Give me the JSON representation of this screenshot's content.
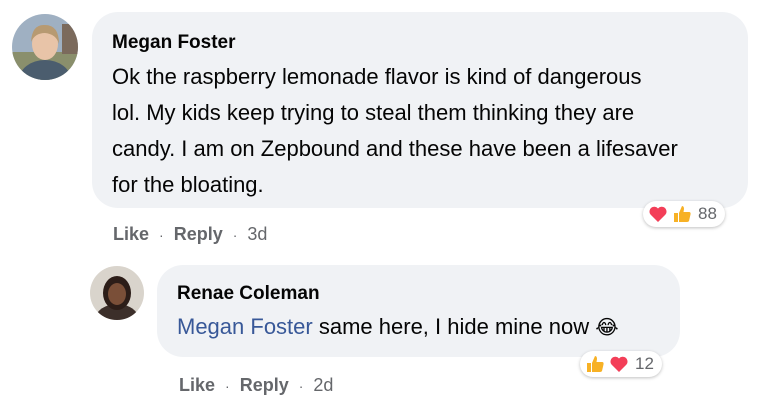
{
  "comments": [
    {
      "author": "Megan Foster",
      "text": "Ok the raspberry lemonade flavor is kind of dangerous lol. My kids keep trying to steal them thinking they are candy. I am on Zepbound and these have been a lifesaver for the bloating.",
      "lines": [
        "Ok the raspberry lemonade flavor is kind of dangerous",
        "lol. My kids keep trying to steal them thinking they are",
        "candy. I am on Zepbound and these have been a lifesaver",
        "for the bloating."
      ],
      "reactions": {
        "icons": [
          "heart-icon",
          "thumbs-up-icon"
        ],
        "count": "88"
      },
      "actions": {
        "like": "Like",
        "reply": "Reply",
        "time": "3d"
      }
    },
    {
      "author": "Renae Coleman",
      "mention": "Megan Foster",
      "text": "same here, I hide mine now",
      "emoji": "😂",
      "reactions": {
        "icons": [
          "thumbs-up-icon",
          "heart-icon"
        ],
        "count": "12"
      },
      "actions": {
        "like": "Like",
        "reply": "Reply",
        "time": "2d"
      }
    }
  ],
  "colors": {
    "bubble": "#f0f2f5",
    "mention": "#385898",
    "meta": "#65676b",
    "heart": "#f33e58",
    "like": "#f7b125"
  }
}
